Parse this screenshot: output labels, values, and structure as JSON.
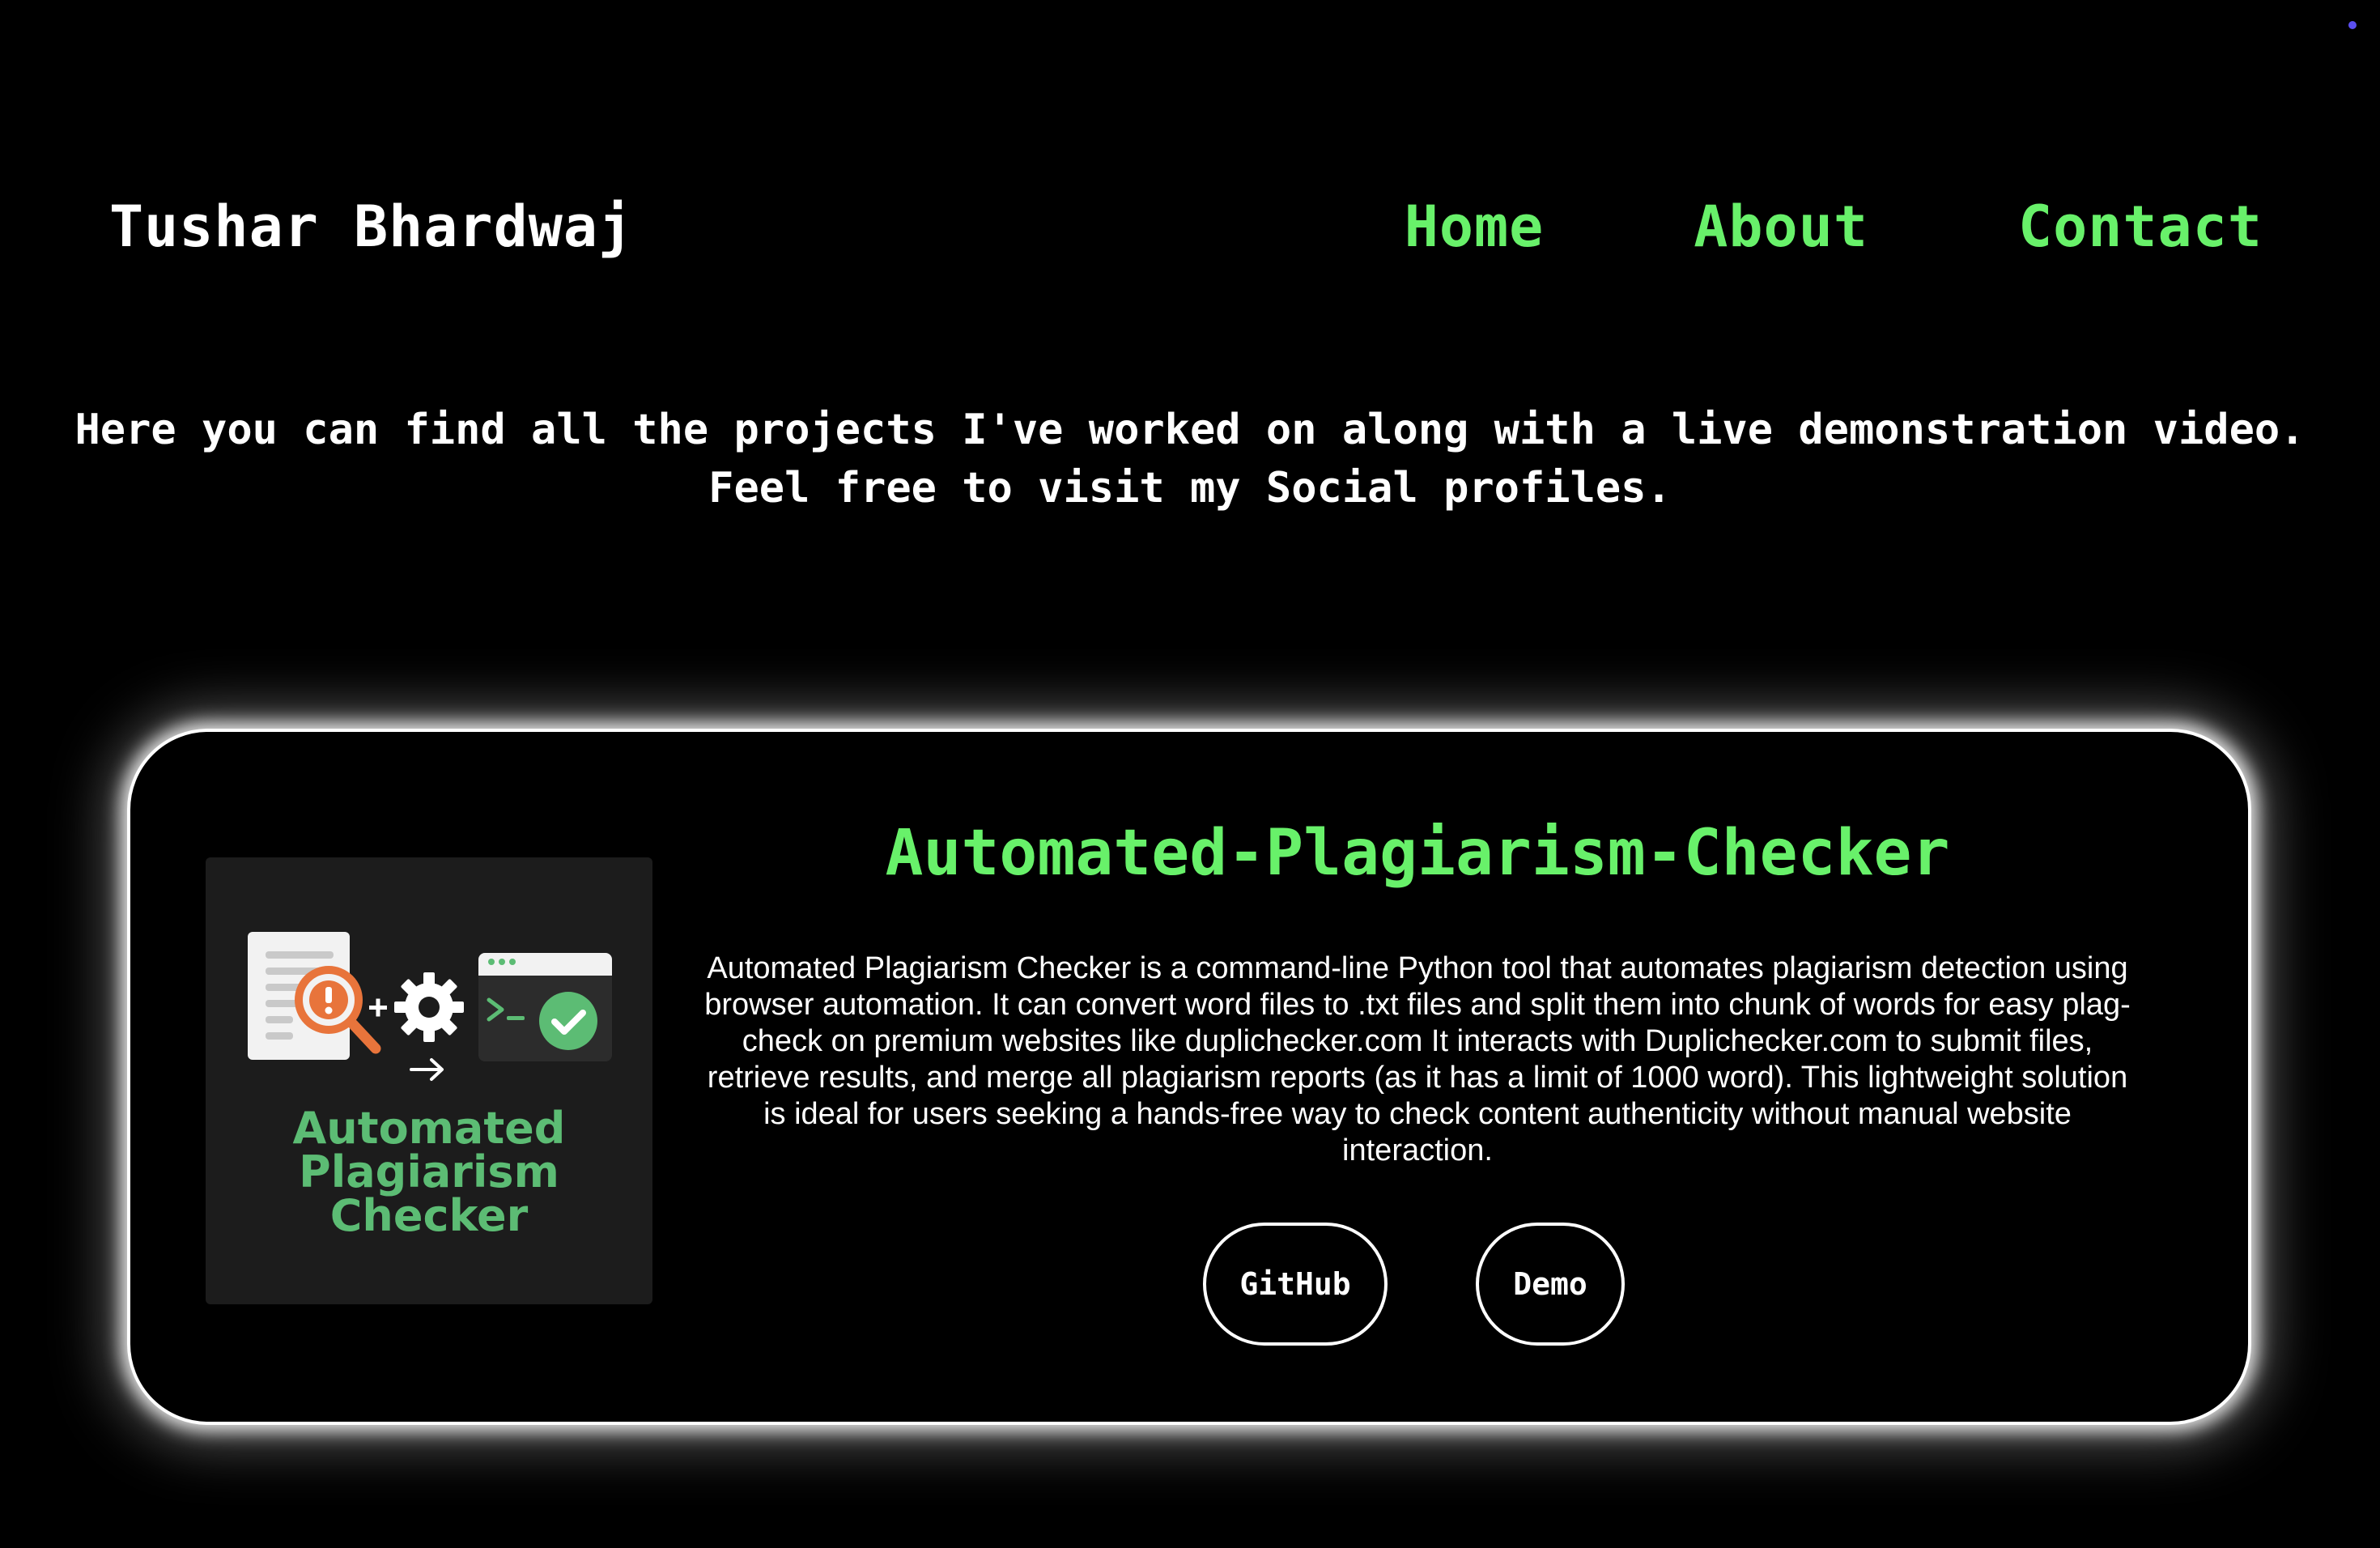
{
  "header": {
    "brand": "Tushar Bhardwaj",
    "nav": [
      {
        "label": "Home"
      },
      {
        "label": "About"
      },
      {
        "label": "Contact"
      }
    ]
  },
  "intro": {
    "line1": "Here you can find all the projects I've worked on along with a live demonstration video.",
    "line2": "Feel free to visit my Social profiles."
  },
  "project": {
    "thumbnail_title_lines": [
      "Automated",
      "Plagiarism",
      "Checker"
    ],
    "title": "Automated-Plagiarism-Checker",
    "description": "Automated Plagiarism Checker is a command-line Python tool that automates plagiarism detection using browser automation. It can convert word files to .txt files and split them into chunk of words for easy plag-check on premium websites like duplichecker.com It interacts with Duplichecker.com to submit files, retrieve results, and merge all plagiarism reports (as it has a limit of 1000 word). This lightweight solution is ideal for users seeking a hands-free way to check content authenticity without manual website interaction.",
    "buttons": {
      "github": "GitHub",
      "demo": "Demo"
    },
    "thumbnail_icons": [
      "document-icon",
      "magnifier-alert-icon",
      "plus-icon",
      "gear-icon",
      "arrow-right-icon",
      "terminal-window-icon",
      "check-circle-icon"
    ]
  },
  "colors": {
    "background": "#000000",
    "accent_green": "#68f16a",
    "thumb_green": "#5cbc74",
    "thumb_background": "#1c1c1c",
    "magnifier_orange": "#e8743b"
  }
}
